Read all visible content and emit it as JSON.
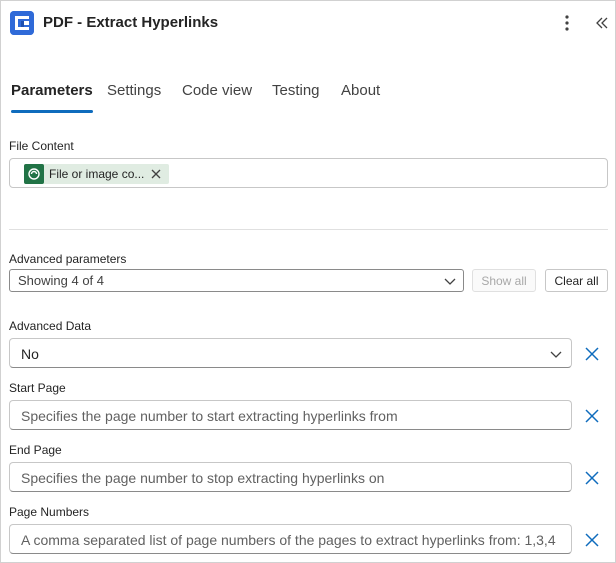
{
  "header": {
    "title": "PDF - Extract Hyperlinks",
    "icon": "pdf-connector-icon",
    "more_icon": "more-vertical-icon",
    "collapse_icon": "double-chevron-left-icon"
  },
  "tabs": [
    {
      "label": "Parameters",
      "active": true
    },
    {
      "label": "Settings",
      "active": false
    },
    {
      "label": "Code view",
      "active": false
    },
    {
      "label": "Testing",
      "active": false
    },
    {
      "label": "About",
      "active": false
    }
  ],
  "file_content": {
    "label": "File Content",
    "token_text": "File or image co...",
    "token_icon": "dataverse-icon"
  },
  "advanced_parameters": {
    "label": "Advanced parameters",
    "value": "Showing 4 of 4",
    "show_all_label": "Show all",
    "clear_all_label": "Clear all"
  },
  "fields": {
    "advanced_data": {
      "label": "Advanced Data",
      "value": "No"
    },
    "start_page": {
      "label": "Start Page",
      "placeholder": "Specifies the page number to start extracting hyperlinks from"
    },
    "end_page": {
      "label": "End Page",
      "placeholder": "Specifies the page number to stop extracting hyperlinks on"
    },
    "page_numbers": {
      "label": "Page Numbers",
      "placeholder": "A comma separated list of page numbers of the pages to extract hyperlinks from: 1,3,4"
    }
  },
  "colors": {
    "accent": "#0f6cbd",
    "token_bg": "#e0ece2",
    "token_icon_bg": "#217346",
    "app_icon_bg": "#2f6ad8"
  }
}
